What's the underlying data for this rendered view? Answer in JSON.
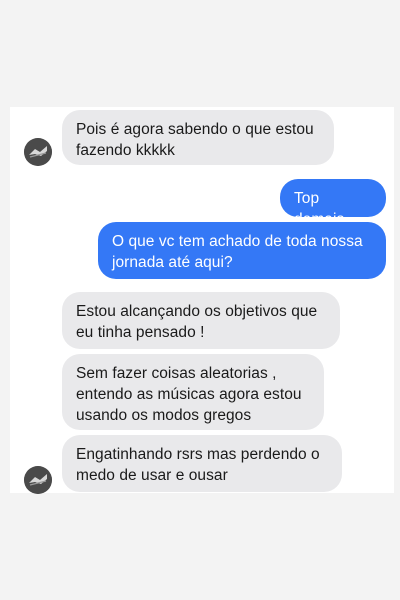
{
  "colors": {
    "incoming_bubble": "#e9e9eb",
    "outgoing_bubble": "#3478f6",
    "background": "#f3f3f3",
    "chat_panel": "#ffffff"
  },
  "messages": [
    {
      "side": "incoming",
      "text": "Pois é agora sabendo o que estou fazendo kkkkk",
      "has_avatar": true
    },
    {
      "side": "outgoing",
      "text": "Top demais"
    },
    {
      "side": "outgoing",
      "text": "O que vc tem achado de toda nossa jornada até aqui?"
    },
    {
      "side": "incoming",
      "text": "Estou alcançando os objetivos que eu tinha pensado !"
    },
    {
      "side": "incoming",
      "text": "Sem fazer coisas aleatorias , entendo as músicas agora estou usando os modos gregos"
    },
    {
      "side": "incoming",
      "text": "Engatinhando rsrs mas perdendo o medo de usar e ousar",
      "has_avatar": true
    }
  ],
  "avatar_icon": "profile-photo-icon"
}
